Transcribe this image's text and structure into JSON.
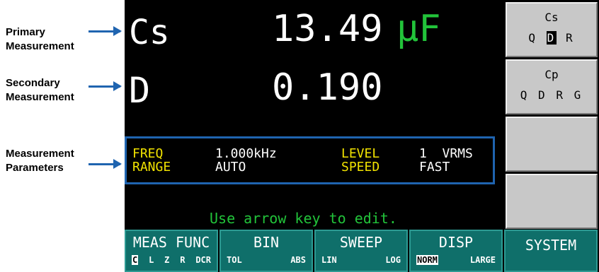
{
  "annotations": {
    "primary_l1": "Primary",
    "primary_l2": "Measurement",
    "secondary_l1": "Secondary",
    "secondary_l2": "Measurement",
    "params_l1": "Measurement",
    "params_l2": "Parameters"
  },
  "primary": {
    "param": "Cs",
    "value": "13.49",
    "unit": "μF",
    "unit_color": "#22c33a"
  },
  "secondary": {
    "param": "D",
    "value": "0.190"
  },
  "sidebar": [
    {
      "title": "Cs",
      "options": "Q D R",
      "selected": "D"
    },
    {
      "title": "Cp",
      "options": "Q D R G"
    },
    {
      "title": ""
    },
    {
      "title": ""
    }
  ],
  "params": {
    "freq_label": "FREQ",
    "freq_value": "1.000kHz",
    "level_label": "LEVEL",
    "level_value": "1  VRMS",
    "range_label": "RANGE",
    "range_value": "AUTO",
    "speed_label": "SPEED",
    "speed_value": "FAST"
  },
  "hint": "Use arrow key to edit.",
  "bottom": [
    {
      "label": "MEAS FUNC",
      "subs": [
        "C",
        "L",
        "Z",
        "R",
        "DCR"
      ],
      "selected": "C"
    },
    {
      "label": "BIN",
      "subs": [
        "TOL",
        "ABS"
      ]
    },
    {
      "label": "SWEEP",
      "subs": [
        "LIN",
        "LOG"
      ]
    },
    {
      "label": "DISP",
      "subs": [
        "NORM",
        "LARGE"
      ],
      "selected": "NORM"
    },
    {
      "label": "SYSTEM",
      "subs": []
    }
  ],
  "colors": {
    "accent_blue": "#1f64b0",
    "label_yellow": "#f2e300",
    "hint_green": "#22c33a",
    "button_teal": "#0f6f6a"
  }
}
